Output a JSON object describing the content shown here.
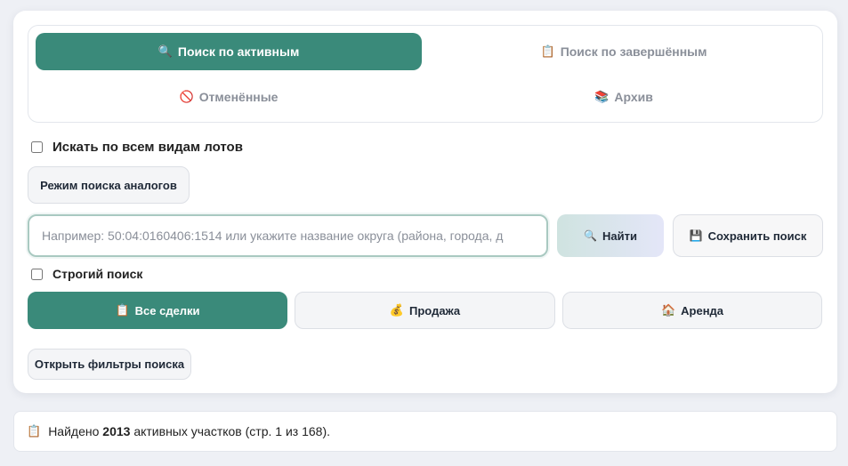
{
  "tabs": [
    {
      "icon": "🔍",
      "label": "Поиск по активным",
      "active": true
    },
    {
      "icon": "📋",
      "label": "Поиск по завершённым",
      "active": false
    },
    {
      "icon": "🚫",
      "label": "Отменённые",
      "active": false
    },
    {
      "icon": "📚",
      "label": "Архив",
      "active": false
    }
  ],
  "options": {
    "all_lots_label": "Искать по всем видам лотов",
    "strict_label": "Строгий поиск"
  },
  "analog_button": "Режим поиска аналогов",
  "search": {
    "placeholder": "Например: 50:04:0160406:1514 или укажите название округа (района, города, д",
    "value": ""
  },
  "find_button": {
    "icon": "🔍",
    "label": "Найти"
  },
  "save_button": {
    "icon": "💾",
    "label": "Сохранить поиск"
  },
  "deal_types": [
    {
      "icon": "📋",
      "label": "Все сделки",
      "active": true
    },
    {
      "icon": "💰",
      "label": "Продажа",
      "active": false
    },
    {
      "icon": "🏠",
      "label": "Аренда",
      "active": false
    }
  ],
  "filters_button": "Открыть фильтры поиска",
  "result": {
    "icon": "📋",
    "prefix": "Найдено",
    "count": "2013",
    "suffix": "активных участков (стр. 1 из 168)."
  },
  "colors": {
    "accent": "#3a8a7a",
    "background": "#eef0f5"
  }
}
